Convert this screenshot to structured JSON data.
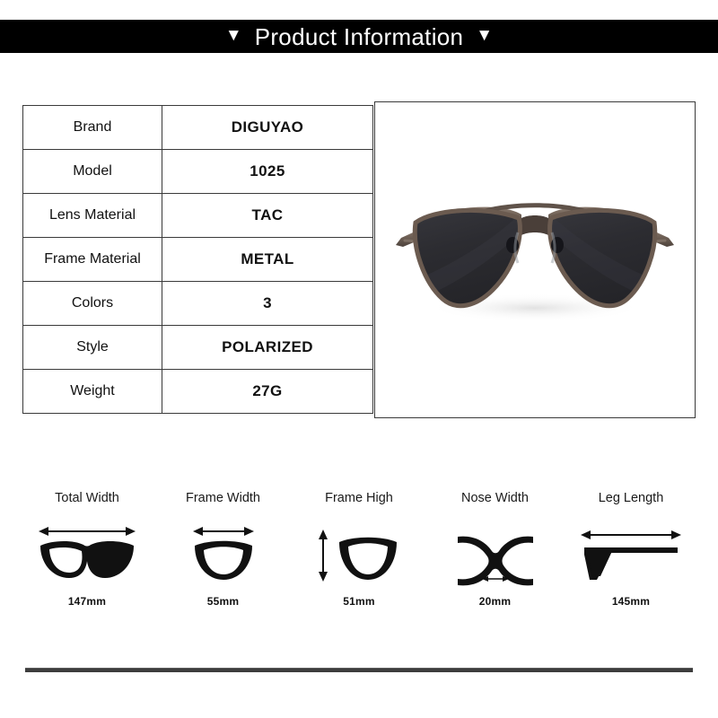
{
  "header": {
    "title": "Product Information",
    "left_marker": "▼",
    "right_marker": "▼",
    "background_color": "#000000",
    "text_color": "#ffffff"
  },
  "spec_table": {
    "rows": [
      {
        "label": "Brand",
        "value": "DIGUYAO"
      },
      {
        "label": "Model",
        "value": "1025"
      },
      {
        "label": "Lens Material",
        "value": "TAC"
      },
      {
        "label": "Frame Material",
        "value": "METAL"
      },
      {
        "label": "Colors",
        "value": "3"
      },
      {
        "label": "Style",
        "value": "POLARIZED"
      },
      {
        "label": "Weight",
        "value": "27G"
      }
    ]
  },
  "product_image": {
    "alt": "aviator sunglasses front view",
    "frame_color": "#6d5f57",
    "lens_color": "#2b2b30",
    "background_color": "#ffffff"
  },
  "measurements": [
    {
      "label": "Total Width",
      "value": "147mm",
      "icon": "full-frame-horizontal-arrow-icon"
    },
    {
      "label": "Frame Width",
      "value": "55mm",
      "icon": "single-lens-horizontal-arrow-icon"
    },
    {
      "label": "Frame High",
      "value": "51mm",
      "icon": "single-lens-vertical-arrow-icon"
    },
    {
      "label": "Nose Width",
      "value": "20mm",
      "icon": "nose-bridge-icon"
    },
    {
      "label": "Leg Length",
      "value": "145mm",
      "icon": "temple-arm-icon"
    }
  ],
  "footer": {
    "divider_color": "#3d3d3d"
  }
}
